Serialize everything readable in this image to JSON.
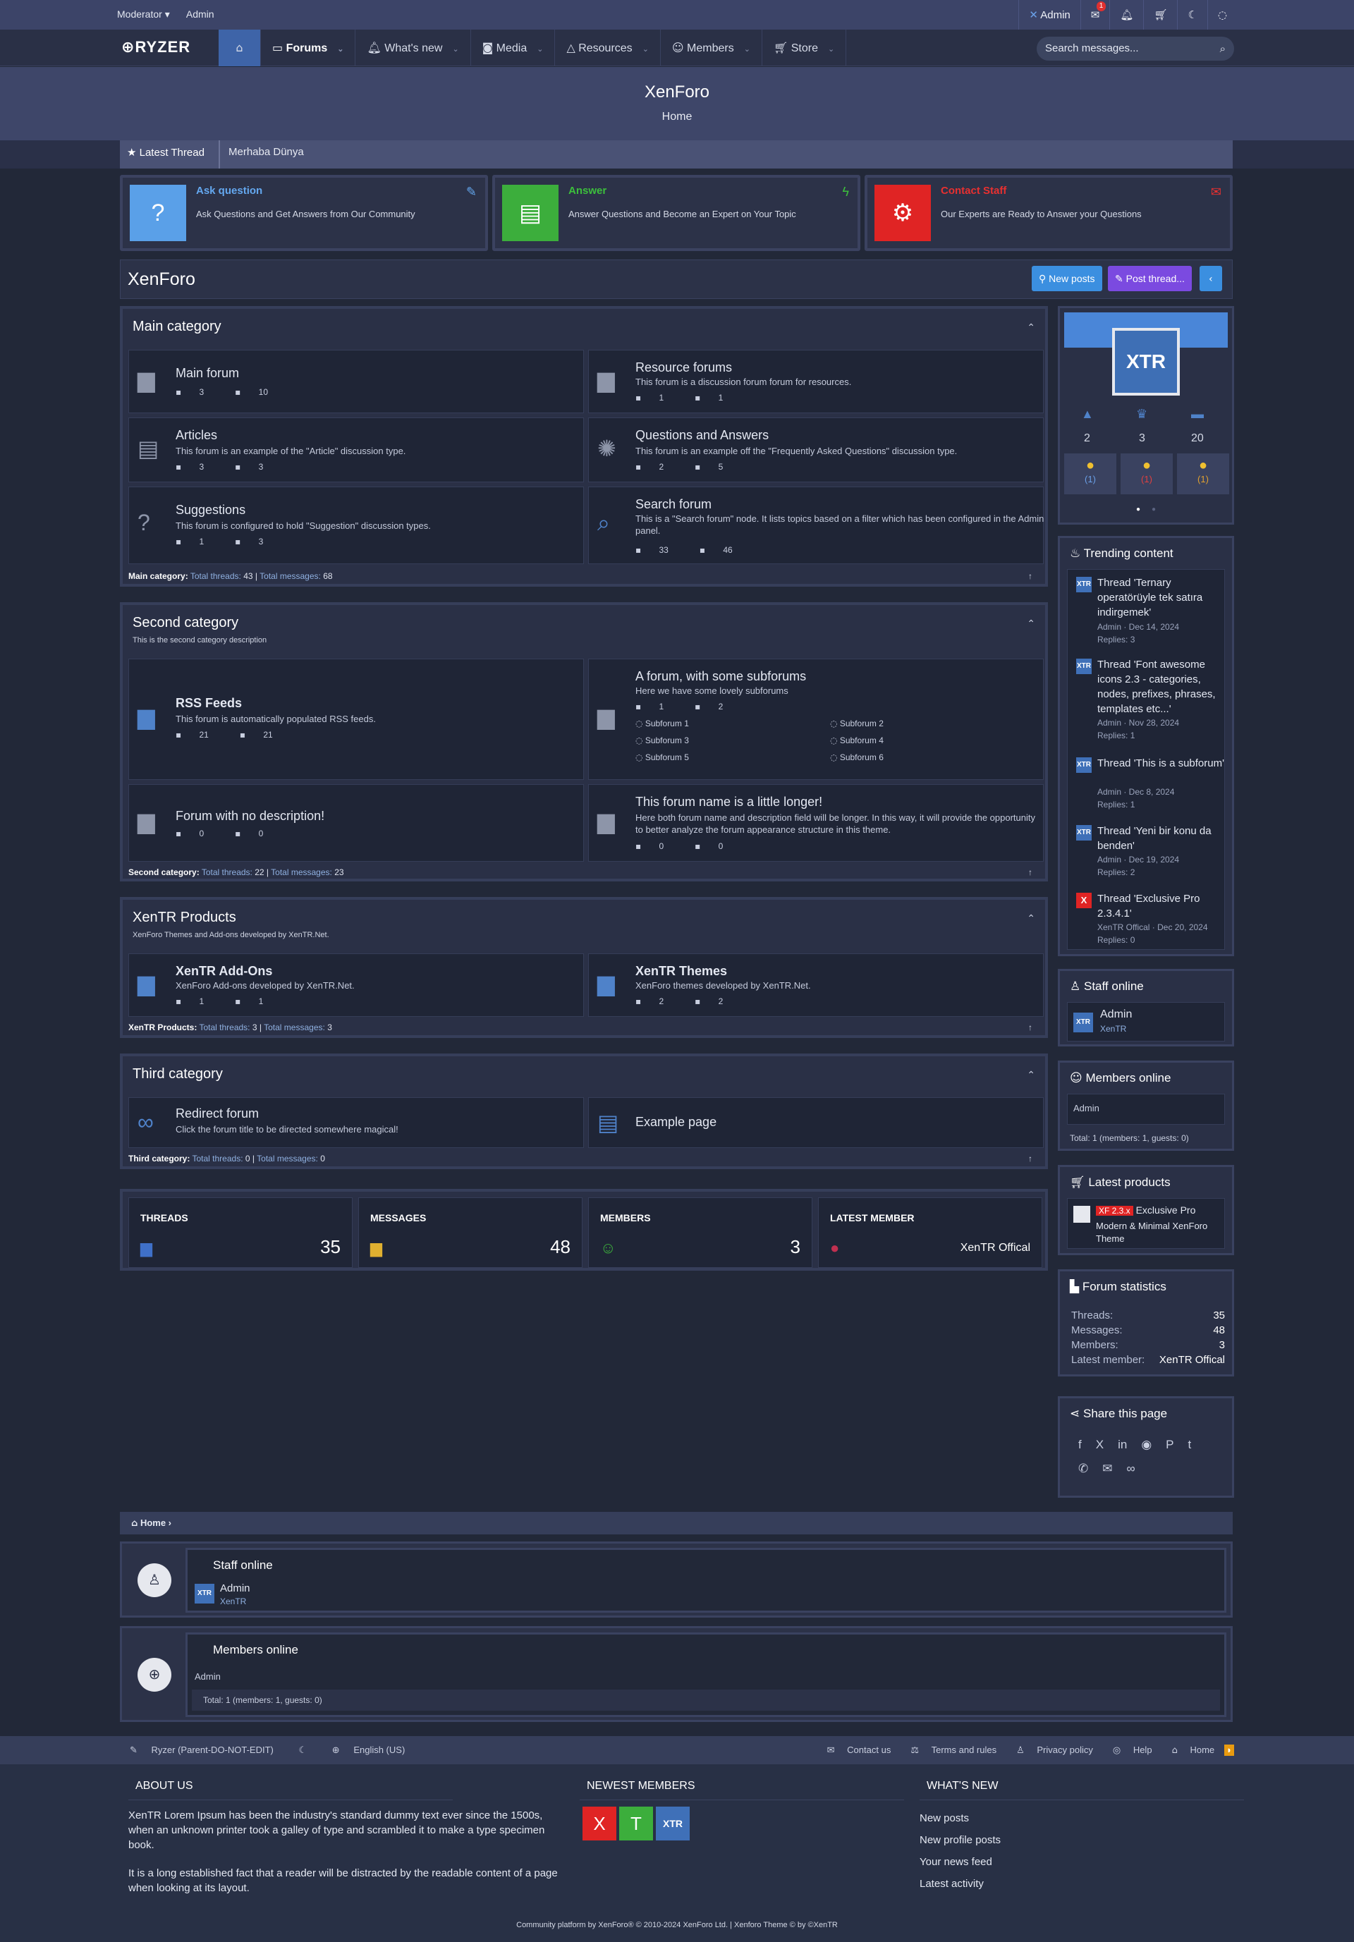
{
  "topbar": {
    "left": [
      "Moderator ▾",
      "Admin"
    ],
    "user": "Admin",
    "badge": "1"
  },
  "nav": {
    "logo": "RYZER",
    "tabs": [
      "Forums",
      "What's new",
      "Media",
      "Resources",
      "Members",
      "Store"
    ],
    "search_placeholder": "Search messages..."
  },
  "header": {
    "title": "XenForo",
    "subtitle": "Home"
  },
  "ticker": {
    "label": "Latest Thread",
    "item": "Merhaba Dünya"
  },
  "cards": [
    {
      "title": "Ask question",
      "desc": "Ask Questions and Get Answers from Our Community",
      "color": "#5aa0e8",
      "tcolor": "#64a8f0"
    },
    {
      "title": "Answer",
      "desc": "Answer Questions and Become an Expert on Your Topic",
      "color": "#3cae3c",
      "tcolor": "#3cbf3c"
    },
    {
      "title": "Contact Staff",
      "desc": "Our Experts are Ready to Answer your Questions",
      "color": "#e02424",
      "tcolor": "#e83030"
    }
  ],
  "page": {
    "title": "XenForo",
    "new_posts": "New posts",
    "post_thread": "Post thread..."
  },
  "cat1": {
    "title": "Main category",
    "nodes": [
      {
        "t": "Main forum",
        "d": "",
        "a": "3",
        "b": "10"
      },
      {
        "t": "Resource forums",
        "d": "This forum is a discussion forum forum for resources.",
        "a": "1",
        "b": "1"
      },
      {
        "t": "Articles",
        "d": "This forum is an example of the \"Article\" discussion type.",
        "a": "3",
        "b": "3"
      },
      {
        "t": "Questions and Answers",
        "d": "This forum is an example off the \"Frequently Asked Questions\" discussion type.",
        "a": "2",
        "b": "5"
      },
      {
        "t": "Suggestions",
        "d": "This forum is configured to hold \"Suggestion\" discussion types.",
        "a": "1",
        "b": "3"
      },
      {
        "t": "Search forum",
        "d": "This is a \"Search forum\" node. It lists topics based on a filter which has been configured in the Admin panel.",
        "a": "33",
        "b": "46"
      }
    ],
    "foot": {
      "name": "Main category:",
      "threads": "43",
      "messages": "68"
    }
  },
  "cat2": {
    "title": "Second category",
    "desc": "This is the second category description",
    "nodes": [
      {
        "t": "RSS Feeds",
        "d": "This forum is automatically populated RSS feeds.",
        "a": "21",
        "b": "21"
      },
      {
        "t": "A forum, with some subforums",
        "d": "Here we have some lovely subforums",
        "a": "1",
        "b": "2"
      },
      {
        "t": "Forum with no description!",
        "d": "",
        "a": "0",
        "b": "0"
      },
      {
        "t": "This forum name is a little longer!",
        "d": "Here both forum name and description field will be longer. In this way, it will provide the opportunity to better analyze the forum appearance structure in this theme.",
        "a": "0",
        "b": "0"
      }
    ],
    "subs": [
      "Subforum 1",
      "Subforum 2",
      "Subforum 3",
      "Subforum 4",
      "Subforum 5",
      "Subforum 6"
    ],
    "foot": {
      "name": "Second category:",
      "threads": "22",
      "messages": "23"
    }
  },
  "cat3": {
    "title": "XenTR Products",
    "desc": "XenForo Themes and Add-ons developed by XenTR.Net.",
    "nodes": [
      {
        "t": "XenTR Add-Ons",
        "d": "XenForo Add-ons developed by XenTR.Net.",
        "a": "1",
        "b": "1"
      },
      {
        "t": "XenTR Themes",
        "d": "XenForo themes developed by XenTR.Net.",
        "a": "2",
        "b": "2"
      }
    ],
    "foot": {
      "name": "XenTR Products:",
      "threads": "3",
      "messages": "3"
    }
  },
  "cat4": {
    "title": "Third category",
    "nodes": [
      {
        "t": "Redirect forum",
        "d": "Click the forum title to be directed somewhere magical!"
      },
      {
        "t": "Example page",
        "d": ""
      }
    ],
    "foot": {
      "name": "Third category:",
      "threads": "0",
      "messages": "0"
    }
  },
  "labels": {
    "total_threads": "Total threads:",
    "total_messages": "Total messages:"
  },
  "stats": [
    {
      "label": "THREADS",
      "value": "35"
    },
    {
      "label": "MESSAGES",
      "value": "48"
    },
    {
      "label": "MEMBERS",
      "value": "3"
    },
    {
      "label": "LATEST MEMBER",
      "value": "XenTR Offical"
    }
  ],
  "profile": {
    "counts": [
      "2",
      "3",
      "20"
    ],
    "reactions": [
      "(1)",
      "(1)",
      "(1)"
    ],
    "logo": "XTR"
  },
  "trending": {
    "title": "Trending content",
    "items": [
      {
        "t": "Thread 'Ternary operatörüyle tek satıra indirgemek'",
        "m": "Admin · Dec 14, 2024",
        "r": "Replies: 3"
      },
      {
        "t": "Thread 'Font awesome icons 2.3 - categories, nodes, prefixes, phrases, templates etc...'",
        "m": "Admin · Nov 28, 2024",
        "r": "Replies: 1"
      },
      {
        "t": "Thread 'This is a subforum'",
        "m": "Admin · Dec 8, 2024",
        "r": "Replies: 1"
      },
      {
        "t": "Thread 'Yeni bir konu da benden'",
        "m": "Admin · Dec 19, 2024",
        "r": "Replies: 2"
      },
      {
        "t": "Thread 'Exclusive Pro 2.3.4.1'",
        "m": "XenTR Offical · Dec 20, 2024",
        "r": "Replies: 0"
      }
    ]
  },
  "staff": {
    "title": "Staff online",
    "name": "Admin",
    "role": "XenTR"
  },
  "members": {
    "title": "Members online",
    "list": "Admin",
    "total": "Total: 1 (members: 1, guests: 0)"
  },
  "products": {
    "title": "Latest products",
    "tag": "XF 2.3.x",
    "name": "Exclusive Pro",
    "desc": "Modern & Minimal XenForo Theme"
  },
  "forumstats": {
    "title": "Forum statistics",
    "rows": [
      [
        "Threads:",
        "35"
      ],
      [
        "Messages:",
        "48"
      ],
      [
        "Members:",
        "3"
      ],
      [
        "Latest member:",
        "XenTR Offical"
      ]
    ]
  },
  "share": {
    "title": "Share this page"
  },
  "breadcrumb": "Home",
  "footer": {
    "left": [
      "Ryzer (Parent-DO-NOT-EDIT)",
      "English (US)"
    ],
    "links": [
      "Contact us",
      "Terms and rules",
      "Privacy policy",
      "Help",
      "Home"
    ],
    "about_h": "ABOUT US",
    "about1": "XenTR Lorem Ipsum has been the industry's standard dummy text ever since the 1500s, when an unknown printer took a galley of type and scrambled it to make a type specimen book.",
    "about2": "It is a long established fact that a reader will be distracted by the readable content of a page when looking at its layout.",
    "newest_h": "NEWEST MEMBERS",
    "whats_h": "WHAT'S NEW",
    "whats": [
      "New posts",
      "New profile posts",
      "Your news feed",
      "Latest activity"
    ],
    "copy": "Community platform by XenForo® © 2010-2024 XenForo Ltd. | Xenforo Theme © by ©XenTR"
  }
}
